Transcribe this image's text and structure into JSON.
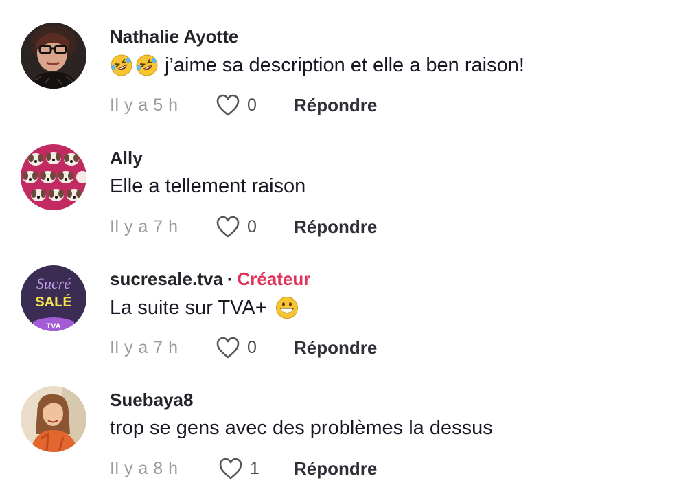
{
  "comments": [
    {
      "author": "Nathalie Ayotte",
      "text": "j’aime sa description et elle a ben raison!",
      "leading_emojis": [
        "rolling-on-floor-laughing",
        "rolling-on-floor-laughing"
      ],
      "timestamp": "Il y a 5 h",
      "likes": "0",
      "reply_label": "Répondre"
    },
    {
      "author": "Ally",
      "text": "Elle a tellement raison",
      "timestamp": "Il y a 7 h",
      "likes": "0",
      "reply_label": "Répondre"
    },
    {
      "author": "sucresale.tva",
      "separator": "·",
      "badge": "Créateur",
      "text": "La suite sur TVA+",
      "trailing_emoji": "grinning-face",
      "avatar_text": {
        "line1": "Sucré",
        "line2": "SALÉ",
        "line3": "TVA"
      },
      "timestamp": "Il y a 7 h",
      "likes": "0",
      "reply_label": "Répondre"
    },
    {
      "author": "Suebaya8",
      "text": "trop se gens avec des problèmes la dessus",
      "timestamp": "Il y a 8 h",
      "likes": "1",
      "reply_label": "Répondre"
    }
  ],
  "colors": {
    "creator_badge": "#e0335a",
    "timestamp": "#9a9a9e",
    "text": "#161823"
  }
}
